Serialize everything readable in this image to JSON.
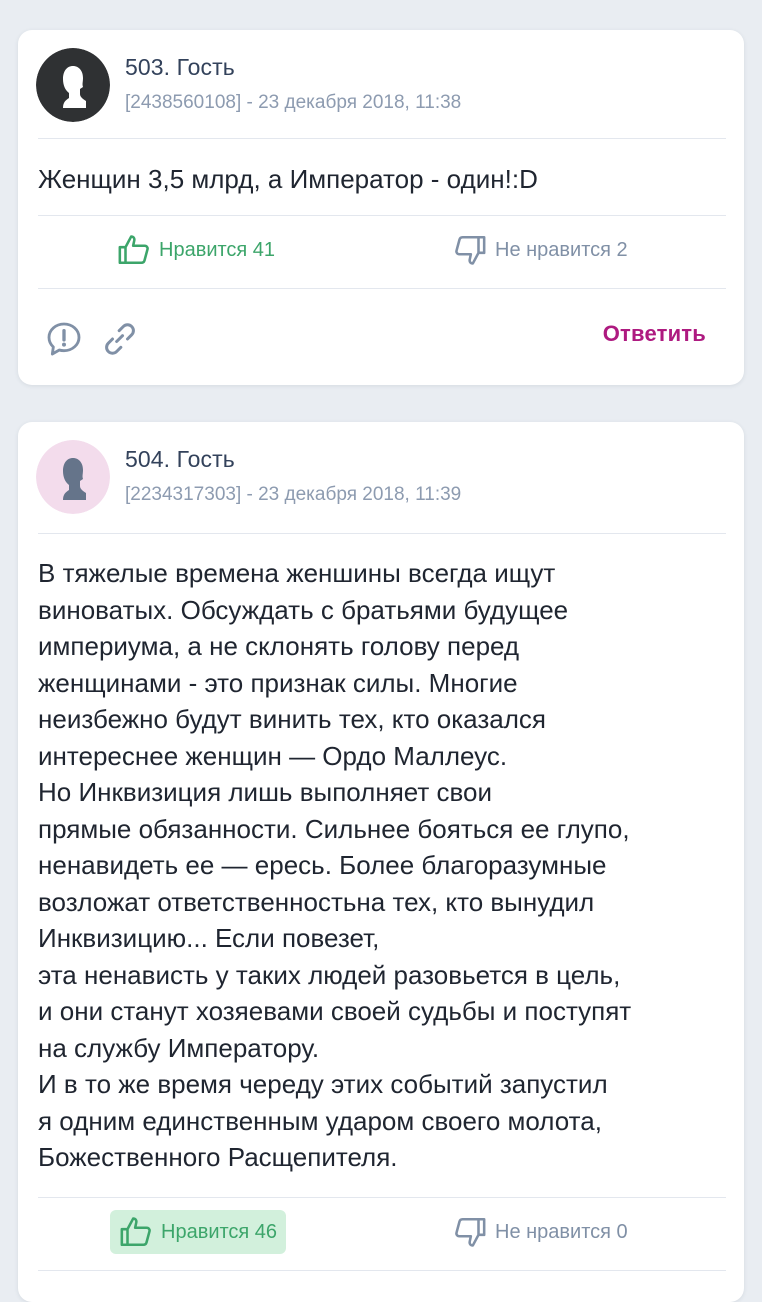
{
  "colors": {
    "background": "#e9edf2",
    "card": "#ffffff",
    "like": "#3ca56a",
    "like_active_bg": "#d2f0dc",
    "dislike": "#8090a6",
    "reply": "#ae1a80",
    "author": "#33425b",
    "meta": "#8d9bb0"
  },
  "comments": [
    {
      "author": "503. Гость",
      "meta": "[2438560108] - 23 декабря 2018, 11:38",
      "avatar_icon": "user-silhouette-dark-avatar-icon",
      "text": "Женщин 3,5 млрд, а Император - один!:D",
      "likes": "Нравится 41",
      "dislikes": "Не нравится 2",
      "reply": "Ответить"
    },
    {
      "author": "504. Гость",
      "meta": "[2234317303] - 23 декабря 2018, 11:39",
      "avatar_icon": "user-silhouette-pink-avatar-icon",
      "text": "В тяжелые времена женшины всегда ищут\nвиноватых. Обсуждать с братьями будущее\nимпериума, а не склонять голову перед\nженщинами - это признак силы. Многие\nнеизбежно будут винить тех, кто оказался\nинтереснее женщин — Ордо Маллеус.\nНо Инквизиция лишь выполняет свои\nпрямые обязанности. Сильнее бояться ее глупо,\nненавидеть ее — ересь. Более благоразумные\nвозложат ответственностьна тех, кто вынудил\nИнквизицию... Если повезет,\nэта ненависть у таких людей разовьется в цель,\nи они станут хозяевами своей судьбы и поступят\nна службу Императору.\nИ в то же время череду этих событий запустил\nя одним единственным ударом своего молота,\nБожественного Расщепителя.",
      "likes": "Нравится 46",
      "dislikes": "Не нравится 0"
    }
  ]
}
